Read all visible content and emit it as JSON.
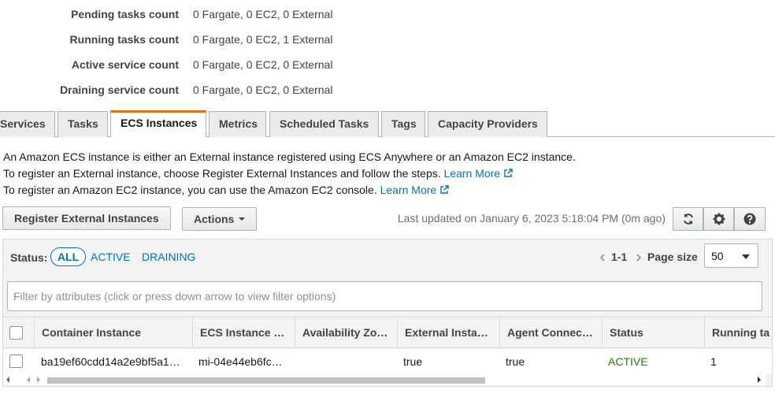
{
  "summary": [
    {
      "label": "Pending tasks count",
      "value": "0 Fargate, 0 EC2, 0 External"
    },
    {
      "label": "Running tasks count",
      "value": "0 Fargate, 0 EC2, 1 External"
    },
    {
      "label": "Active service count",
      "value": "0 Fargate, 0 EC2, 0 External"
    },
    {
      "label": "Draining service count",
      "value": "0 Fargate, 0 EC2, 0 External"
    }
  ],
  "tabs": [
    "Services",
    "Tasks",
    "ECS Instances",
    "Metrics",
    "Scheduled Tasks",
    "Tags",
    "Capacity Providers"
  ],
  "active_tab": "ECS Instances",
  "description": {
    "line1": "An Amazon ECS instance is either an External instance registered using ECS Anywhere or an Amazon EC2 instance.",
    "line2": "To register an External instance, choose Register External Instances and follow the steps.",
    "line3": "To register an Amazon EC2 instance, you can use the Amazon EC2 console.",
    "learn_more": "Learn More"
  },
  "toolbar": {
    "register_label": "Register External Instances",
    "actions_label": "Actions",
    "last_updated": "Last updated on January 6, 2023 5:18:04 PM (0m ago)"
  },
  "filters": {
    "status_label": "Status:",
    "all": "ALL",
    "active": "ACTIVE",
    "draining": "DRAINING"
  },
  "pagination": {
    "range": "1-1",
    "page_size_label": "Page size",
    "page_size": "50"
  },
  "search": {
    "placeholder": "Filter by attributes (click or press down arrow to view filter options)"
  },
  "table": {
    "columns": [
      "Container Instance",
      "ECS Instance …",
      "Availability Zo…",
      "External Insta…",
      "Agent Connec…",
      "Status",
      "Running ta"
    ],
    "rows": [
      {
        "container_instance": "ba19ef60cdd14a2e9bf5a1…",
        "ecs_instance": "mi-04e44eb6fc…",
        "availability_zone": "",
        "external_instance": "true",
        "agent_connected": "true",
        "status": "ACTIVE",
        "running_tasks": "1"
      }
    ]
  },
  "colors": {
    "link": "#0073bb",
    "active_tab_accent": "#ec7211",
    "status_active": "#1d8102"
  }
}
